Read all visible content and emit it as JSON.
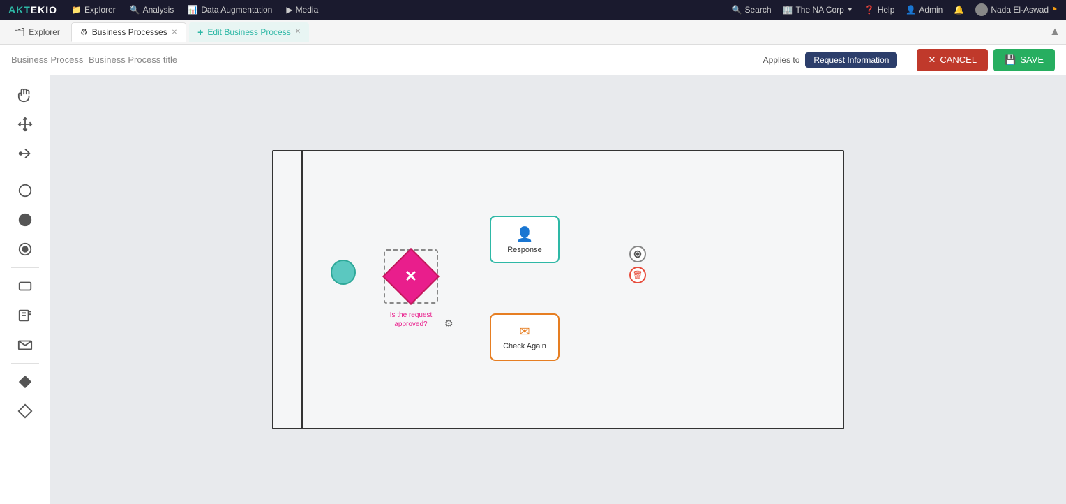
{
  "logo": {
    "text": "AKTEKIO"
  },
  "nav": {
    "items": [
      {
        "id": "explorer",
        "label": "Explorer",
        "icon": "📁"
      },
      {
        "id": "analysis",
        "label": "Analysis",
        "icon": "🔍"
      },
      {
        "id": "data-augmentation",
        "label": "Data Augmentation",
        "icon": "📊"
      },
      {
        "id": "media",
        "label": "Media",
        "icon": "▶"
      }
    ],
    "right": [
      {
        "id": "search",
        "label": "Search",
        "icon": "🔍"
      },
      {
        "id": "the-na-corp",
        "label": "The NA Corp",
        "icon": "🏢"
      },
      {
        "id": "help",
        "label": "Help",
        "icon": "❓"
      },
      {
        "id": "admin",
        "label": "Admin",
        "icon": "👤"
      },
      {
        "id": "notifications",
        "label": "",
        "icon": "🔔"
      },
      {
        "id": "user",
        "label": "Nada El-Aswad",
        "icon": "👤"
      }
    ]
  },
  "tabs": [
    {
      "id": "explorer",
      "label": "Explorer",
      "icon": "🗂",
      "active": false,
      "closable": false
    },
    {
      "id": "business-processes",
      "label": "Business Processes",
      "icon": "⚙",
      "active": false,
      "closable": true
    },
    {
      "id": "edit-bp",
      "label": "Edit Business Process",
      "icon": "+",
      "active": true,
      "closable": true
    }
  ],
  "toolbar": {
    "bp_prefix": "Business Process",
    "bp_title": "Business Process title",
    "applies_to_label": "Applies to",
    "applies_to_value": "Request Information",
    "cancel_label": "CANCEL",
    "save_label": "SAVE"
  },
  "canvas": {
    "swimlane_label": "",
    "nodes": {
      "start": {
        "label": ""
      },
      "decision": {
        "label": "Is the request approved?",
        "icon": "✕"
      },
      "response": {
        "label": "Response",
        "icon": "👤"
      },
      "check_again": {
        "label": "Check Again",
        "icon": "✉"
      }
    }
  },
  "left_tools": [
    {
      "id": "hand",
      "icon": "✋",
      "label": "hand-tool"
    },
    {
      "id": "move",
      "icon": "⬤",
      "label": "move-tool"
    },
    {
      "id": "draw",
      "icon": "✏",
      "label": "draw-tool"
    },
    {
      "id": "sep1",
      "type": "separator"
    },
    {
      "id": "circle-empty",
      "icon": "○",
      "label": "start-event"
    },
    {
      "id": "circle-filled",
      "icon": "●",
      "label": "intermediate-event"
    },
    {
      "id": "circle-target",
      "icon": "◎",
      "label": "end-event"
    },
    {
      "id": "sep2",
      "type": "separator"
    },
    {
      "id": "rect",
      "icon": "▭",
      "label": "task"
    },
    {
      "id": "doc",
      "icon": "🗎",
      "label": "sub-process"
    },
    {
      "id": "mail",
      "icon": "✉",
      "label": "message-task"
    },
    {
      "id": "sep3",
      "type": "separator"
    },
    {
      "id": "diamond",
      "icon": "◆",
      "label": "gateway"
    },
    {
      "id": "diamond-filled",
      "icon": "◇",
      "label": "complex-gateway"
    }
  ]
}
